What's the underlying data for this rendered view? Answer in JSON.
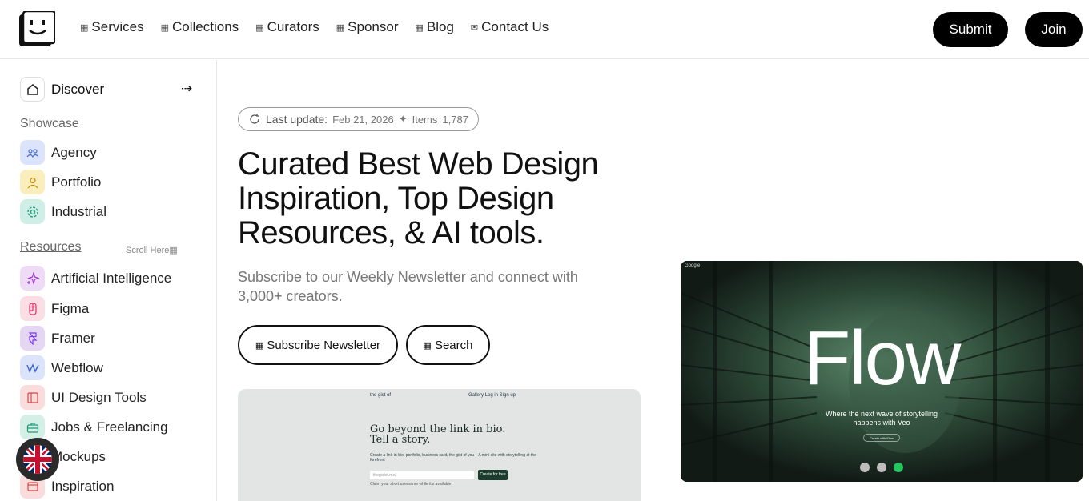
{
  "header": {
    "nav": [
      {
        "label": "Services",
        "icon": "grid-icon"
      },
      {
        "label": "Collections",
        "icon": "grid-icon"
      },
      {
        "label": "Curators",
        "icon": "grid-icon"
      },
      {
        "label": "Sponsor",
        "icon": "grid-icon"
      },
      {
        "label": "Blog",
        "icon": "grid-icon"
      },
      {
        "label": "Contact Us",
        "icon": "mail-icon"
      }
    ],
    "submit_label": "Submit",
    "join_label": "Join"
  },
  "sidebar": {
    "discover_label": "Discover",
    "arrow": "⇢",
    "showcase_title": "Showcase",
    "showcase_items": [
      {
        "label": "Agency",
        "bg": "#dbe4fb",
        "icon": "users-icon"
      },
      {
        "label": "Portfolio",
        "bg": "#fbeebd",
        "icon": "user-icon"
      },
      {
        "label": "Industrial",
        "bg": "#cfeee6",
        "icon": "gear-icon"
      }
    ],
    "resources_title": "Resources",
    "scroll_hint": "Scroll Here",
    "resource_items": [
      {
        "label": "Artificial Intelligence",
        "bg": "#eedcf7",
        "icon": "sparkle-icon"
      },
      {
        "label": "Figma",
        "bg": "#fbdde6",
        "icon": "figma-icon"
      },
      {
        "label": "Framer",
        "bg": "#e5d7f4",
        "icon": "framer-icon"
      },
      {
        "label": "Webflow",
        "bg": "#dbe4fb",
        "icon": "webflow-icon"
      },
      {
        "label": "UI Design Tools",
        "bg": "#fbdcdc",
        "icon": "layout-icon"
      },
      {
        "label": "Jobs & Freelancing",
        "bg": "#d3efe6",
        "icon": "briefcase-icon"
      },
      {
        "label": "Mockups",
        "bg": "#e6e6e6",
        "icon": "device-icon"
      },
      {
        "label": "Inspiration",
        "bg": "#fbdcdc",
        "icon": "window-icon"
      }
    ]
  },
  "main": {
    "pill": {
      "label": "Last update:",
      "date": "Feb 21, 2026",
      "sep": "✦",
      "items_label": "Items",
      "items_count": "1,787"
    },
    "headline": "Curated Best Web Design Inspiration, Top Design Resources, & AI tools.",
    "subtext": "Subscribe to our Weekly Newsletter and connect with 3,000+ creators.",
    "subscribe_label": "Subscribe Newsletter",
    "search_label": "Search"
  },
  "preview": {
    "brand": "the gist of",
    "links": "Gallery   Log in   Sign up",
    "title_line1": "Go beyond the link in bio.",
    "title_line2": "Tell a story.",
    "body": "Create a link-in-bio, portfolio, business card, the gist of you – A mini-site with storytelling at the forefront",
    "input_placeholder": "thegistof.me/",
    "button": "Create for free",
    "note": "Claim your short username while it's available"
  },
  "hero": {
    "brand": "Google",
    "title": "Flow",
    "tagline_line1": "Where the next wave of storytelling",
    "tagline_line2": "happens with Veo",
    "button": "Create with Flow",
    "dots": [
      {
        "color": "#bdbdbd"
      },
      {
        "color": "#bdbdbd"
      },
      {
        "color": "#22c55e"
      }
    ]
  }
}
